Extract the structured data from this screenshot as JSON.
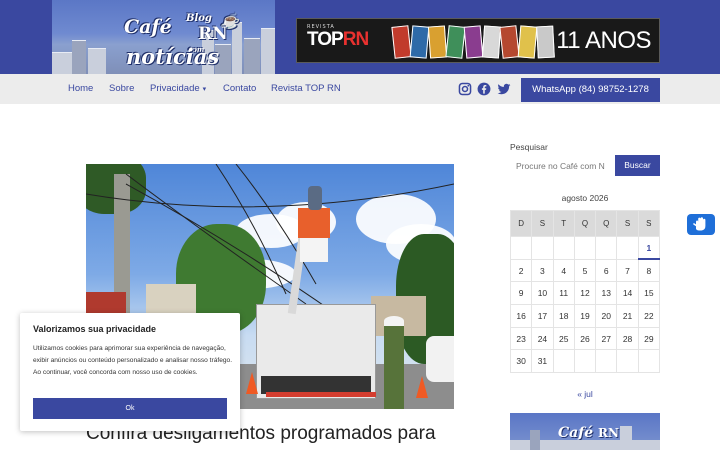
{
  "header": {
    "logo": {
      "cafe": "Café",
      "blog": "Blog",
      "rn": "RN",
      "com": "com",
      "noticias": "notícias"
    },
    "banner": {
      "revista": "REVISTA",
      "top": "TOP",
      "rn": "RN",
      "anos": "11 ANOS"
    }
  },
  "nav": {
    "items": [
      "Home",
      "Sobre",
      "Privacidade",
      "Contato",
      "Revista TOP RN"
    ],
    "social": [
      "instagram-icon",
      "facebook-icon",
      "twitter-icon"
    ],
    "whatsapp_label": "WhatsApp (84) 98752-1278"
  },
  "article": {
    "title": "Confira desligamentos programados para"
  },
  "cookie": {
    "title": "Valorizamos sua privacidade",
    "text": "Utilizamos cookies para aprimorar sua experiência de navegação, exibir anúncios ou conteúdo personalizado e analisar nosso tráfego. Ao continuar, você concorda com nosso uso de cookies.",
    "button": "Ok"
  },
  "sidebar": {
    "search": {
      "label": "Pesquisar",
      "placeholder": "Procure no Café com N",
      "button": "Buscar"
    },
    "calendar": {
      "caption": "agosto 2026",
      "weekdays": [
        "D",
        "S",
        "T",
        "Q",
        "Q",
        "S",
        "S"
      ],
      "weeks": [
        [
          "",
          "",
          "",
          "",
          "",
          "",
          "1"
        ],
        [
          "2",
          "3",
          "4",
          "5",
          "6",
          "7",
          "8"
        ],
        [
          "9",
          "10",
          "11",
          "12",
          "13",
          "14",
          "15"
        ],
        [
          "16",
          "17",
          "18",
          "19",
          "20",
          "21",
          "22"
        ],
        [
          "23",
          "24",
          "25",
          "26",
          "27",
          "28",
          "29"
        ],
        [
          "30",
          "31",
          "",
          "",
          "",
          "",
          ""
        ]
      ],
      "today": "1",
      "prev_link": "« jul"
    },
    "banner": {
      "cafe": "Café",
      "rn": "RN"
    }
  },
  "colors": {
    "brand": "#3a48a0",
    "nav_bg": "#ececec",
    "access": "#1f6fd8"
  }
}
